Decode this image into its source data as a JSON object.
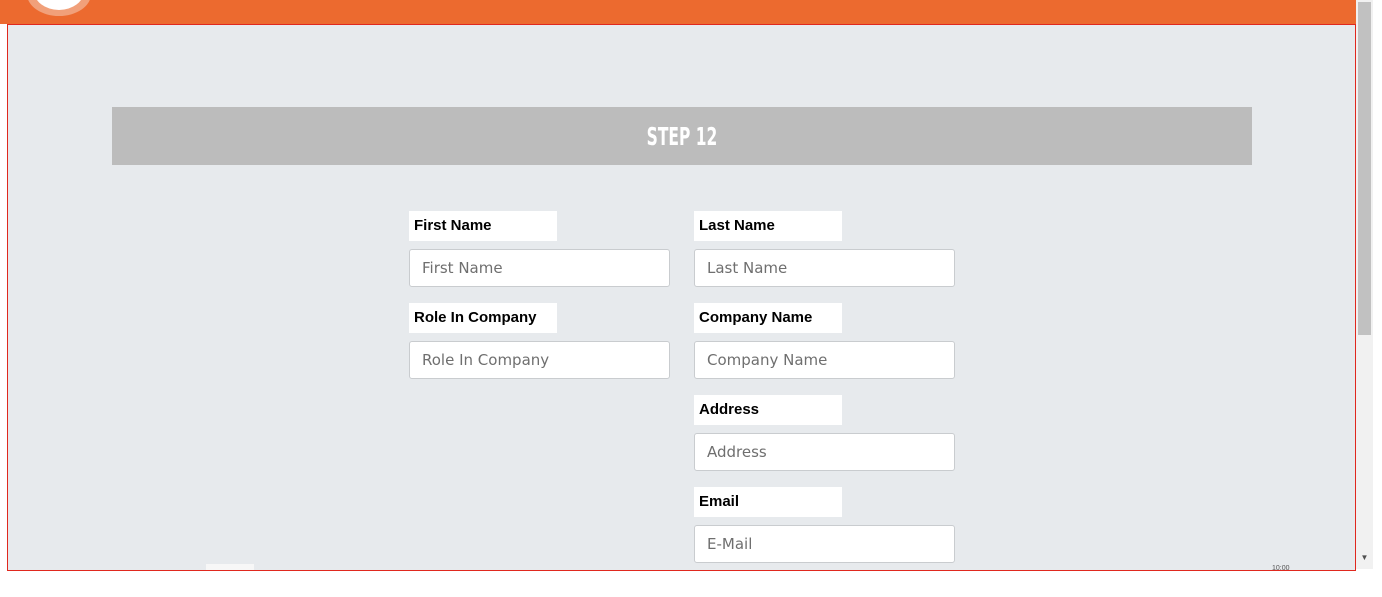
{
  "header": {
    "logo_icon": "logo-icon",
    "brand_color": "#ec6a2f"
  },
  "step": {
    "title": "STEP 12"
  },
  "form": {
    "first_name": {
      "label": "First Name",
      "placeholder": "First Name"
    },
    "last_name": {
      "label": "Last Name",
      "placeholder": "Last Name"
    },
    "role": {
      "label": "Role In Company",
      "placeholder": "Role In Company"
    },
    "company": {
      "label": "Company Name",
      "placeholder": "Company Name"
    },
    "address": {
      "label": "Address",
      "placeholder": "Address"
    },
    "email": {
      "label": "Email",
      "placeholder": "E-Mail"
    }
  },
  "footer": {
    "partial_text": "10:00"
  },
  "scrollbar": {
    "down_icon": "arrow-down-icon"
  }
}
